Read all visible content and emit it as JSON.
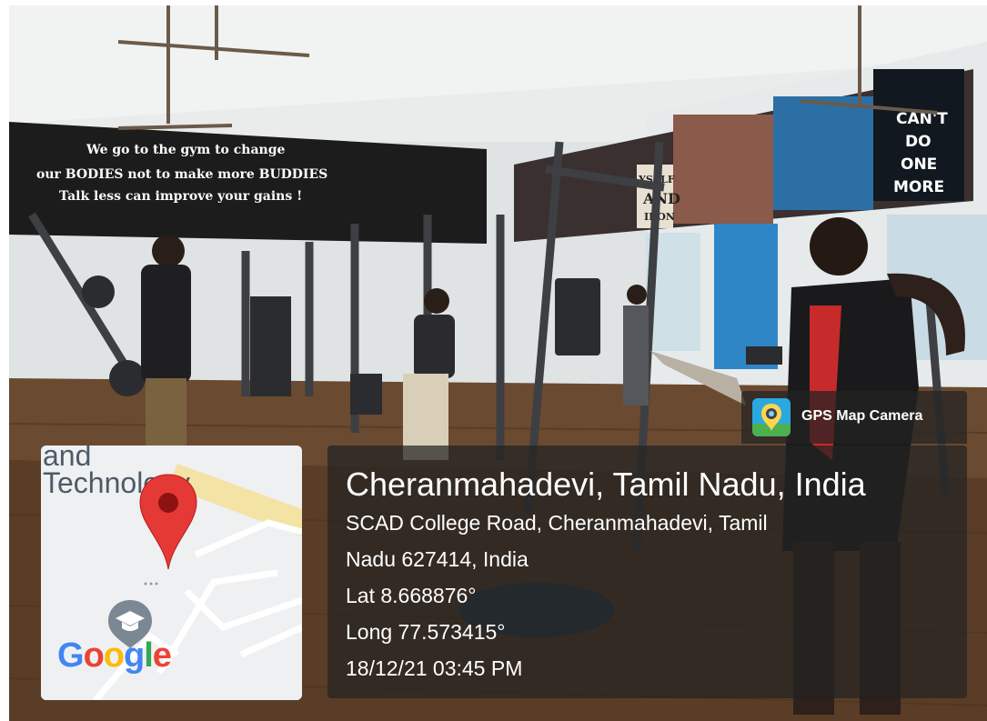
{
  "photo": {
    "description_icon": "gym-interior-photo",
    "banner_text": [
      "We go to the gym to change",
      "our BODIES not to make more BUDDIES",
      "Talk less can improve your gains !"
    ],
    "poster_text_1": [
      "CAN'T",
      "DO",
      "ONE",
      "MORE"
    ],
    "poster_text_2": [
      "YSELF",
      "AND",
      "IRON"
    ]
  },
  "map": {
    "label_line1": "and",
    "label_line2": "Technology",
    "pin_icon": "map-pin-icon",
    "education_icon": "graduation-cap-icon",
    "brand": "Google"
  },
  "badge": {
    "app_icon": "gps-camera-icon",
    "app_name": "GPS Map Camera"
  },
  "location": {
    "title": "Cheranmahadevi, Tamil Nadu, India",
    "address_line1": "SCAD College Road, Cheranmahadevi, Tamil",
    "address_line2": "Nadu 627414, India",
    "lat": "Lat 8.668876°",
    "long": "Long 77.573415°",
    "datetime": "18/12/21 03:45 PM"
  },
  "colors": {
    "google_blue": "#4285F4",
    "google_red": "#EA4335",
    "google_yellow": "#FBBC05",
    "google_green": "#34A853",
    "pin_red": "#E53935",
    "overlay": "#232323"
  }
}
